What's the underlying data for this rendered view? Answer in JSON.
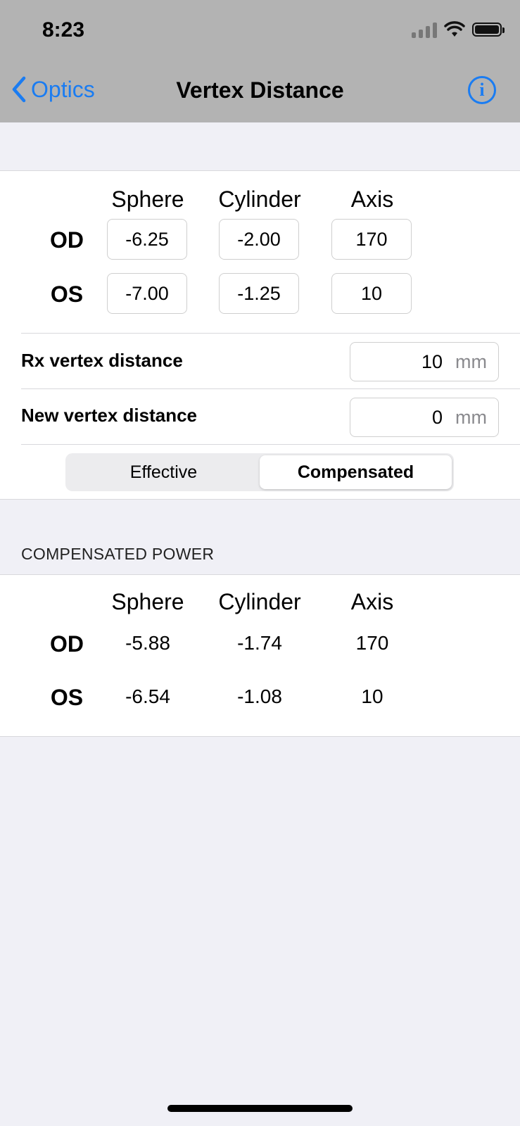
{
  "status_bar": {
    "time": "8:23"
  },
  "nav": {
    "back_label": "Optics",
    "title": "Vertex Distance",
    "info_icon": "info-icon"
  },
  "prescription": {
    "columns": [
      "Sphere",
      "Cylinder",
      "Axis"
    ],
    "rows": [
      {
        "label": "OD",
        "sphere": "-6.25",
        "cylinder": "-2.00",
        "axis": "170"
      },
      {
        "label": "OS",
        "sphere": "-7.00",
        "cylinder": "-1.25",
        "axis": "10"
      }
    ]
  },
  "rx_vertex": {
    "label": "Rx vertex distance",
    "value": "10",
    "unit": "mm"
  },
  "new_vertex": {
    "label": "New vertex distance",
    "value": "0",
    "unit": "mm"
  },
  "segment": {
    "options": [
      "Effective",
      "Compensated"
    ],
    "selected": "Compensated"
  },
  "result": {
    "header": "COMPENSATED POWER",
    "columns": [
      "Sphere",
      "Cylinder",
      "Axis"
    ],
    "rows": [
      {
        "label": "OD",
        "sphere": "-5.88",
        "cylinder": "-1.74",
        "axis": "170"
      },
      {
        "label": "OS",
        "sphere": "-6.54",
        "cylinder": "-1.08",
        "axis": "10"
      }
    ]
  },
  "colors": {
    "accent": "#1a7cf2",
    "background": "#f0f0f6",
    "header": "#b3b3b3"
  }
}
